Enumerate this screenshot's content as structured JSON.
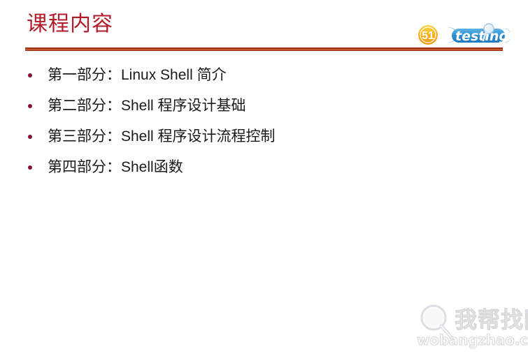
{
  "slide": {
    "title": "课程内容",
    "background_color": "#ffffff",
    "title_color": "#b01c28",
    "rule_color": "#a0341b",
    "bullet_color": "#7d1430",
    "body_text_color": "#1a1a1a"
  },
  "bullets": [
    {
      "text": "第一部分：Linux Shell 简介"
    },
    {
      "text": "第二部分：Shell 程序设计基础"
    },
    {
      "text": "第三部分：Shell 程序设计流程控制"
    },
    {
      "text": "第四部分：Shell函数"
    }
  ],
  "logo": {
    "badge_text": "51",
    "word_text": "testing",
    "badge_color": "#f5a31a",
    "badge_inner_color": "#f7c948",
    "band_color": "#2f8fd4",
    "band_light_color": "#8fc9ec",
    "word_color": "#ffffff",
    "icon": "magnifier-icon"
  },
  "watermark": {
    "cn_text": "我帮找网",
    "domain_text": "wobangzhao.com",
    "color": "#e8eaee",
    "icon": "magnifier-icon"
  }
}
